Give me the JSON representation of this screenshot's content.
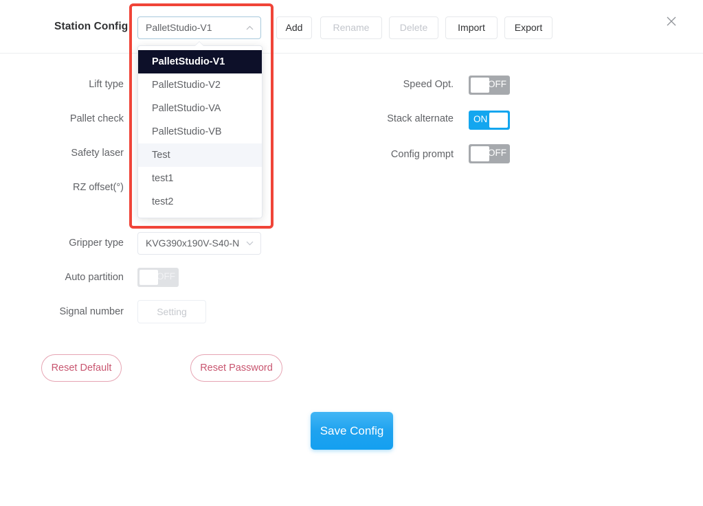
{
  "header": {
    "title": "Station Config",
    "station_select": {
      "value": "PalletStudio-V1",
      "chevron": "chevron-up-icon"
    },
    "buttons": [
      {
        "label": "Add",
        "enabled": true
      },
      {
        "label": "Rename",
        "enabled": false
      },
      {
        "label": "Delete",
        "enabled": false
      },
      {
        "label": "Import",
        "enabled": true
      },
      {
        "label": "Export",
        "enabled": true
      }
    ],
    "close_icon": "close-icon"
  },
  "dropdown": {
    "open": true,
    "items": [
      {
        "label": "PalletStudio-V1",
        "state": "selected"
      },
      {
        "label": "PalletStudio-V2",
        "state": "normal"
      },
      {
        "label": "PalletStudio-VA",
        "state": "normal"
      },
      {
        "label": "PalletStudio-VB",
        "state": "normal"
      },
      {
        "label": "Test",
        "state": "hovered"
      },
      {
        "label": "test1",
        "state": "normal"
      },
      {
        "label": "test2",
        "state": "normal"
      }
    ]
  },
  "form": {
    "left_labels": {
      "lift_type": "Lift type",
      "pallet_check": "Pallet check",
      "safety_laser": "Safety laser",
      "rz_offset": "RZ offset(°)",
      "gripper_type": "Gripper type",
      "auto_partition": "Auto partition",
      "signal_number": "Signal number"
    },
    "right_labels": {
      "speed_opt": "Speed Opt.",
      "stack_alternate": "Stack alternate",
      "config_prompt": "Config prompt"
    },
    "gripper_select": {
      "value": "KVG390x190V-S40-N",
      "chevron": "chevron-down-icon"
    },
    "toggles": {
      "auto_partition": {
        "state": "OFF",
        "disabled": true
      },
      "speed_opt": {
        "state": "OFF",
        "disabled": false
      },
      "stack_alternate": {
        "state": "ON",
        "disabled": false
      },
      "config_prompt": {
        "state": "OFF",
        "disabled": false
      }
    },
    "signal_setting_button": {
      "label": "Setting",
      "enabled": false
    }
  },
  "actions": {
    "reset_default": "Reset Default",
    "reset_password": "Reset Password",
    "save_config": "Save Config"
  },
  "colors": {
    "accent_blue": "#13a6ef",
    "annotation_red": "#f04438",
    "reset_pink": "#c8556f",
    "selected_dark": "#0d1029",
    "toggle_off_gray": "#a6a9ad"
  }
}
